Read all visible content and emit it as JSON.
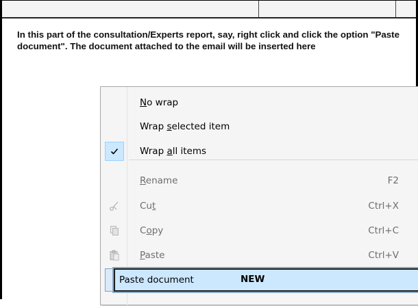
{
  "instruction": {
    "text": "In this part of the consultation/Experts report, say, right click and click the option \"Paste document\". The document attached to the email will be inserted here"
  },
  "menu": {
    "items": [
      {
        "pre": "",
        "u": "N",
        "post": "o wrap",
        "shortcut": "",
        "enabled": true,
        "checked": false,
        "icon": ""
      },
      {
        "pre": "Wrap ",
        "u": "s",
        "post": "elected item",
        "shortcut": "",
        "enabled": true,
        "checked": false,
        "icon": ""
      },
      {
        "pre": "Wrap ",
        "u": "a",
        "post": "ll items",
        "shortcut": "",
        "enabled": true,
        "checked": true,
        "icon": "check-icon"
      },
      {
        "pre": "",
        "u": "R",
        "post": "ename",
        "shortcut": "F2",
        "enabled": false,
        "checked": false,
        "icon": ""
      },
      {
        "pre": "Cu",
        "u": "t",
        "post": "",
        "shortcut": "Ctrl+X",
        "enabled": false,
        "checked": false,
        "icon": "scissors-icon"
      },
      {
        "pre": "C",
        "u": "o",
        "post": "py",
        "shortcut": "Ctrl+C",
        "enabled": false,
        "checked": false,
        "icon": "copy-icon"
      },
      {
        "pre": "",
        "u": "P",
        "post": "aste",
        "shortcut": "Ctrl+V",
        "enabled": false,
        "checked": false,
        "icon": "paste-icon"
      }
    ],
    "paste_document": {
      "label": "Paste document",
      "badge": "NEW"
    }
  },
  "colors": {
    "highlight": "#cce8ff",
    "disabled_text": "#6d6d6d",
    "menu_bg": "#f5f5f5"
  }
}
